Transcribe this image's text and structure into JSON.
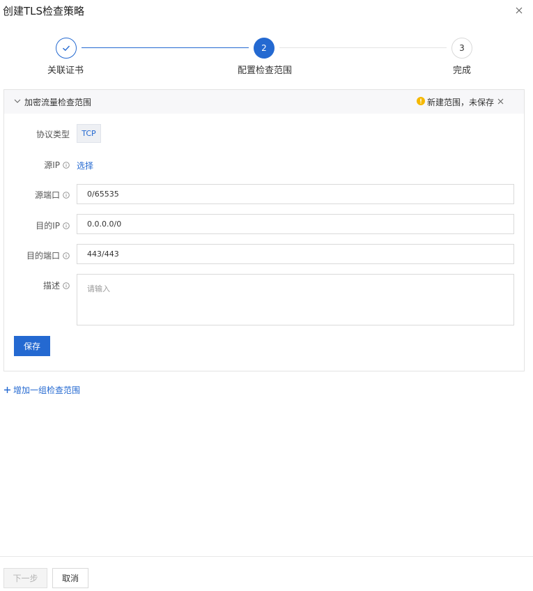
{
  "dialog": {
    "title": "创建TLS检查策略"
  },
  "steps": [
    {
      "number": "1",
      "label": "关联证书",
      "status": "done"
    },
    {
      "number": "2",
      "label": "配置检查范围",
      "status": "current"
    },
    {
      "number": "3",
      "label": "完成",
      "status": "pending"
    }
  ],
  "panel": {
    "title": "加密流量检查范围",
    "warning": "新建范围，未保存",
    "colors": {
      "warning": "#f5b800",
      "accent": "#2469d1"
    }
  },
  "form": {
    "protocol": {
      "label": "协议类型",
      "value": "TCP"
    },
    "source_ip": {
      "label": "源IP",
      "link": "选择"
    },
    "source_port": {
      "label": "源端口",
      "value": "0/65535"
    },
    "dest_ip": {
      "label": "目的IP",
      "value": "0.0.0.0/0"
    },
    "dest_port": {
      "label": "目的端口",
      "value": "443/443"
    },
    "description": {
      "label": "描述",
      "placeholder": "请输入"
    },
    "save_label": "保存"
  },
  "add_group_label": "增加一组检查范围",
  "footer": {
    "next_label": "下一步",
    "cancel_label": "取消"
  }
}
